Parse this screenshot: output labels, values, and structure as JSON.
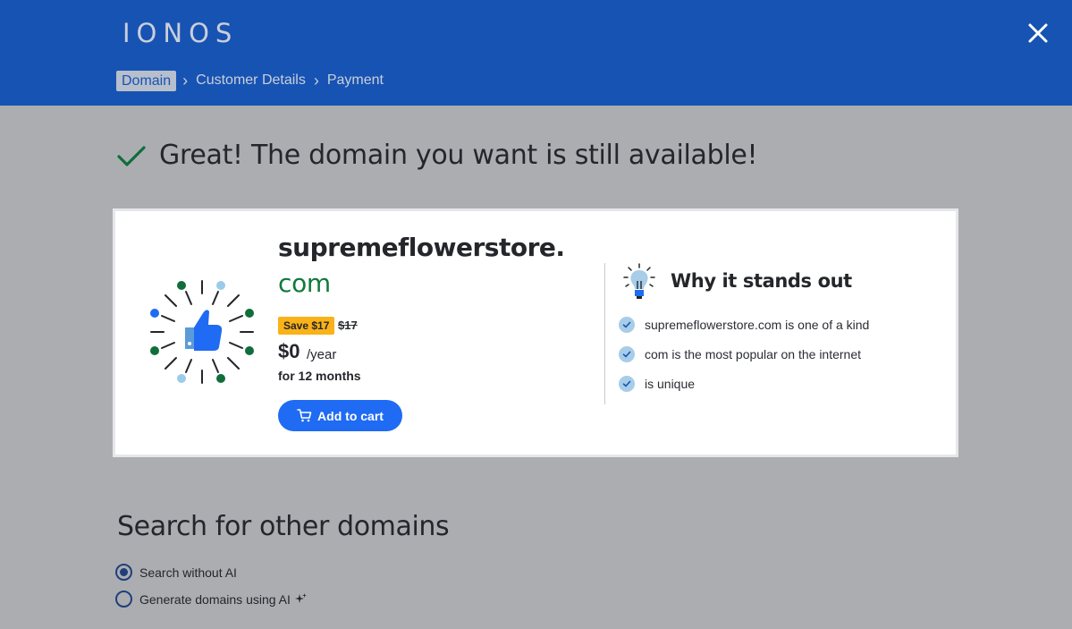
{
  "header": {
    "logo": "IONOS",
    "breadcrumb": [
      "Domain",
      "Customer Details",
      "Payment"
    ],
    "accent_color": "#1753b2"
  },
  "headline": "Great! The domain you want is still available!",
  "result": {
    "domain_name": "supremeflowerstore.",
    "domain_tld": "com",
    "save_badge": "Save $17",
    "old_price": "$17",
    "price": "$0",
    "per": "/year",
    "term": "for 12 months",
    "add_to_cart": "Add to cart"
  },
  "why": {
    "title": "Why it stands out",
    "features": [
      "supremeflowerstore.com is one of a kind",
      "com is the most popular on the internet",
      "is unique"
    ]
  },
  "search": {
    "title": "Search for other domains",
    "options": [
      "Search without AI",
      "Generate domains using AI"
    ],
    "selected": "Search without AI"
  }
}
